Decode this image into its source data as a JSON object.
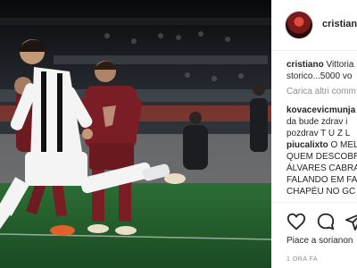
{
  "post": {
    "username": "cristiano",
    "caption_username": "cristiano",
    "caption_text": "Vittoria",
    "caption_text_2": "storico...5000 vo",
    "load_more": "Carica altri comm",
    "comments": [
      {
        "user": "kovacevicmunja",
        "lines": [
          "da bude zdrav i",
          "pozdrav T U Z L"
        ]
      },
      {
        "user": "piucalixto",
        "text": "O MEL",
        "lines": [
          "QUEM DESCOBR",
          "ÁLVARES CABRA",
          "FALANDO EM FA",
          "CHAPÉU NO GC"
        ]
      }
    ],
    "likes": "Piace a sorianon",
    "timestamp": "1 ORA FA"
  },
  "icons": {
    "like": "heart-icon",
    "comment": "comment-bubble-icon",
    "share": "share-icon"
  },
  "colors": {
    "pitch": "#1f5a2c",
    "juventus_primary": "#f4f4f4",
    "torino_maroon": "#7b1d24",
    "text": "#262626",
    "muted": "#8e8e8e"
  }
}
